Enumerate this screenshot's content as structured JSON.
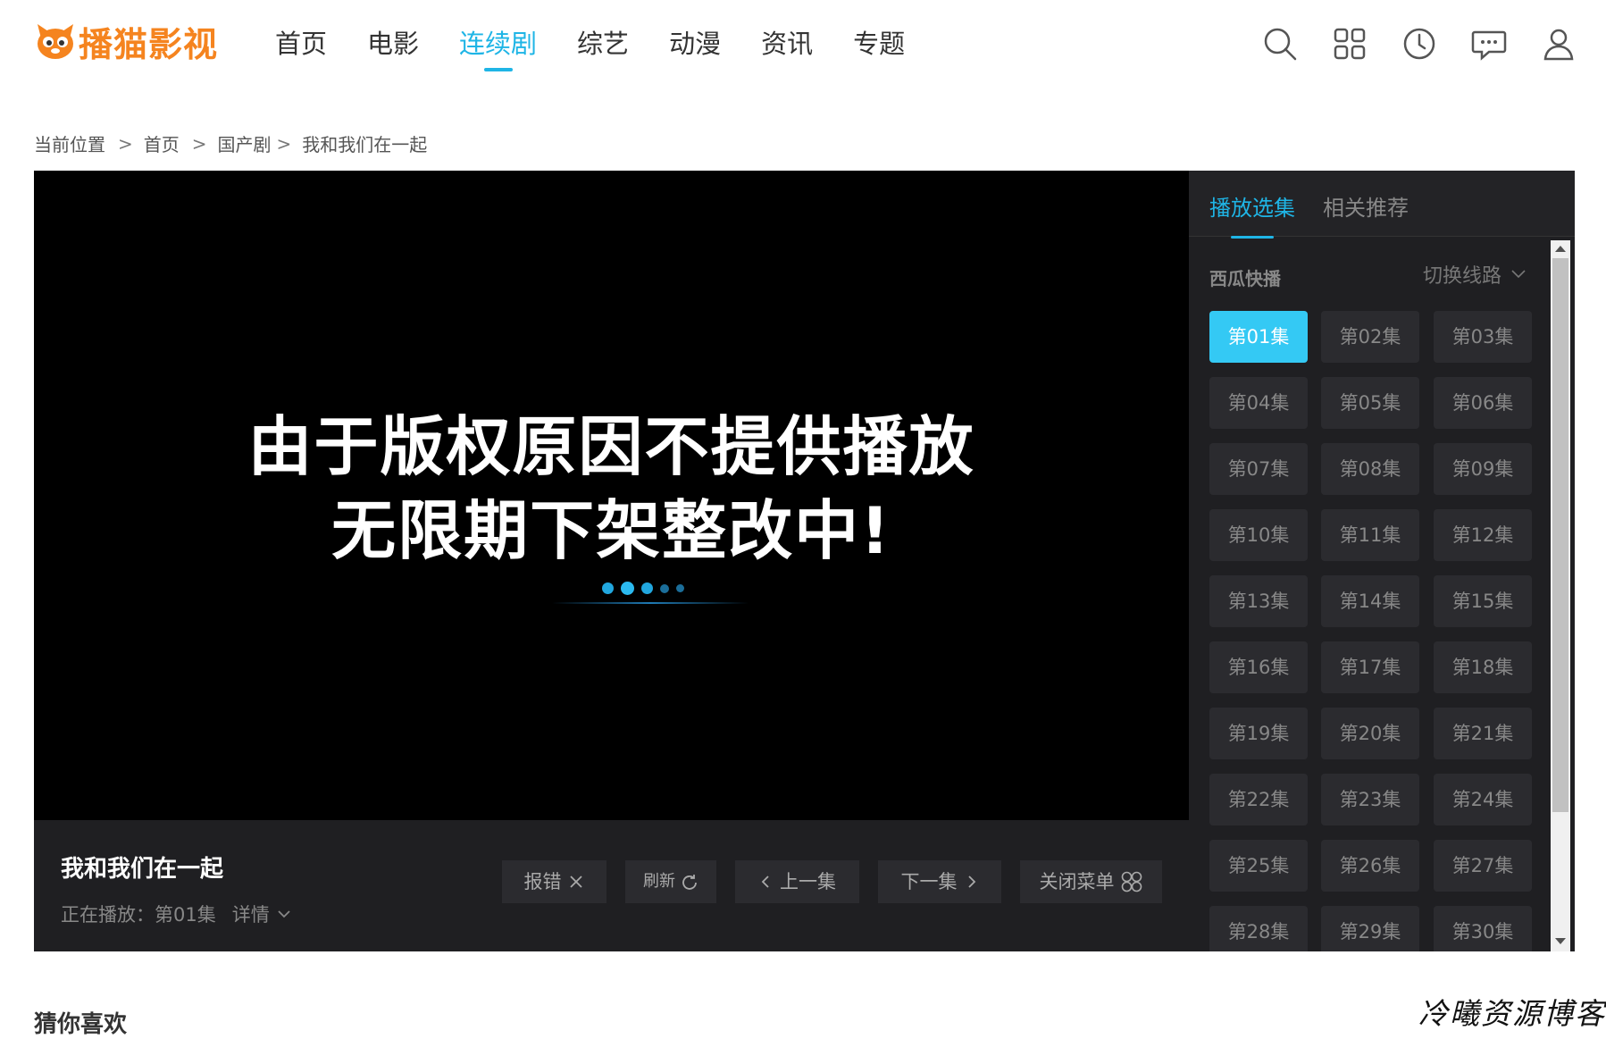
{
  "brand": {
    "name": "播猫影视",
    "accent": "#1fb5e6",
    "logo_color": "#f5841f"
  },
  "nav": {
    "items": [
      {
        "label": "首页",
        "active": false
      },
      {
        "label": "电影",
        "active": false
      },
      {
        "label": "连续剧",
        "active": true
      },
      {
        "label": "综艺",
        "active": false
      },
      {
        "label": "动漫",
        "active": false
      },
      {
        "label": "资讯",
        "active": false
      },
      {
        "label": "专题",
        "active": false
      }
    ]
  },
  "header_icons": [
    "search-icon",
    "grid-icon",
    "history-icon",
    "message-icon",
    "user-icon"
  ],
  "breadcrumb": {
    "prefix": "当前位置",
    "items": [
      "首页",
      "国产剧",
      "我和我们在一起"
    ]
  },
  "player": {
    "message_line1": "由于版权原因不提供播放",
    "message_line2": "无限期下架整改中!",
    "title": "我和我们在一起",
    "now_playing": "正在播放：第01集",
    "detail_label": "详情",
    "controls": {
      "report": "报错",
      "refresh": "刷新",
      "prev": "上一集",
      "next": "下一集",
      "close_menu": "关闭菜单"
    }
  },
  "side": {
    "tabs": [
      {
        "label": "播放选集",
        "active": true
      },
      {
        "label": "相关推荐",
        "active": false
      }
    ],
    "source_name": "西瓜快播",
    "switch_line": "切换线路",
    "episodes": [
      "第01集",
      "第02集",
      "第03集",
      "第04集",
      "第05集",
      "第06集",
      "第07集",
      "第08集",
      "第09集",
      "第10集",
      "第11集",
      "第12集",
      "第13集",
      "第14集",
      "第15集",
      "第16集",
      "第17集",
      "第18集",
      "第19集",
      "第20集",
      "第21集",
      "第22集",
      "第23集",
      "第24集",
      "第25集",
      "第26集",
      "第27集",
      "第28集",
      "第29集",
      "第30集"
    ],
    "active_episode": "第01集"
  },
  "recommend_title": "猜你喜欢",
  "watermark": "冷曦资源博客"
}
